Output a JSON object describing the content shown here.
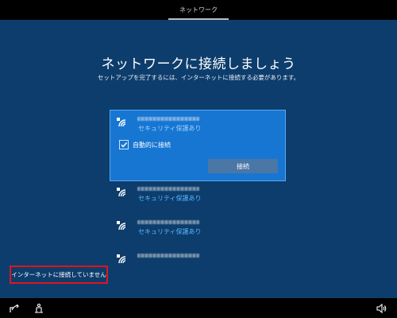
{
  "header": {
    "tab_label": "ネットワーク"
  },
  "main": {
    "title": "ネットワークに接続しましょう",
    "subtitle": "セットアップを完了するには、インターネットに接続する必要があります。"
  },
  "networks": [
    {
      "security": "セキュリティ保護あり",
      "auto_connect_label": "自動的に接続",
      "auto_connect_checked": true,
      "connect_label": "接続",
      "selected": true
    },
    {
      "security": "セキュリティ保護あり"
    },
    {
      "security": "セキュリティ保護あり"
    },
    {
      "security": ""
    }
  ],
  "skip": {
    "label": "インターネットに接続していません"
  },
  "icons": {
    "wifi": "wifi-secured-icon",
    "ease_of_access": "ease-of-access-icon",
    "accessibility": "accessibility-icon",
    "volume": "volume-icon"
  },
  "colors": {
    "background": "#0d3d6c",
    "selected": "#1776d2",
    "secure_text": "#58b6ff",
    "highlight_border": "#e0141d"
  }
}
